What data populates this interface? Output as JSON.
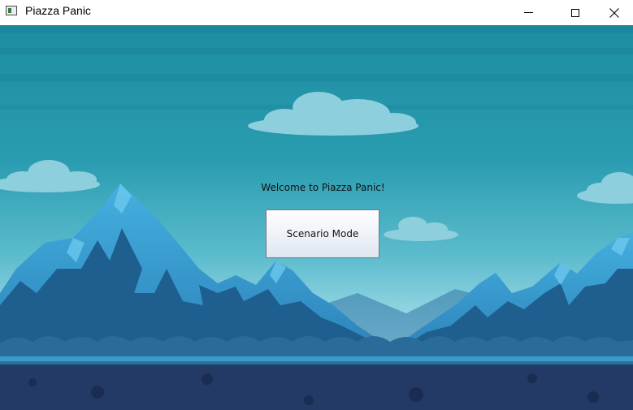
{
  "window": {
    "title": "Piazza Panic",
    "icon": "app-window-icon",
    "controls": [
      "minimize-icon",
      "maximize-icon",
      "close-icon"
    ]
  },
  "menu": {
    "welcome_text": "Welcome to Piazza Panic!",
    "scenario_button_label": "Scenario Mode"
  },
  "colors": {
    "sky_top": "#1f8ea3",
    "sky_horizon": "#bfe6ef",
    "mountain_light": "#3fa8d8",
    "mountain_dark": "#1c5f8c",
    "ground_stripe": "#3a9bc8",
    "ground": "#233a66",
    "cloud": "#8fd0de"
  }
}
